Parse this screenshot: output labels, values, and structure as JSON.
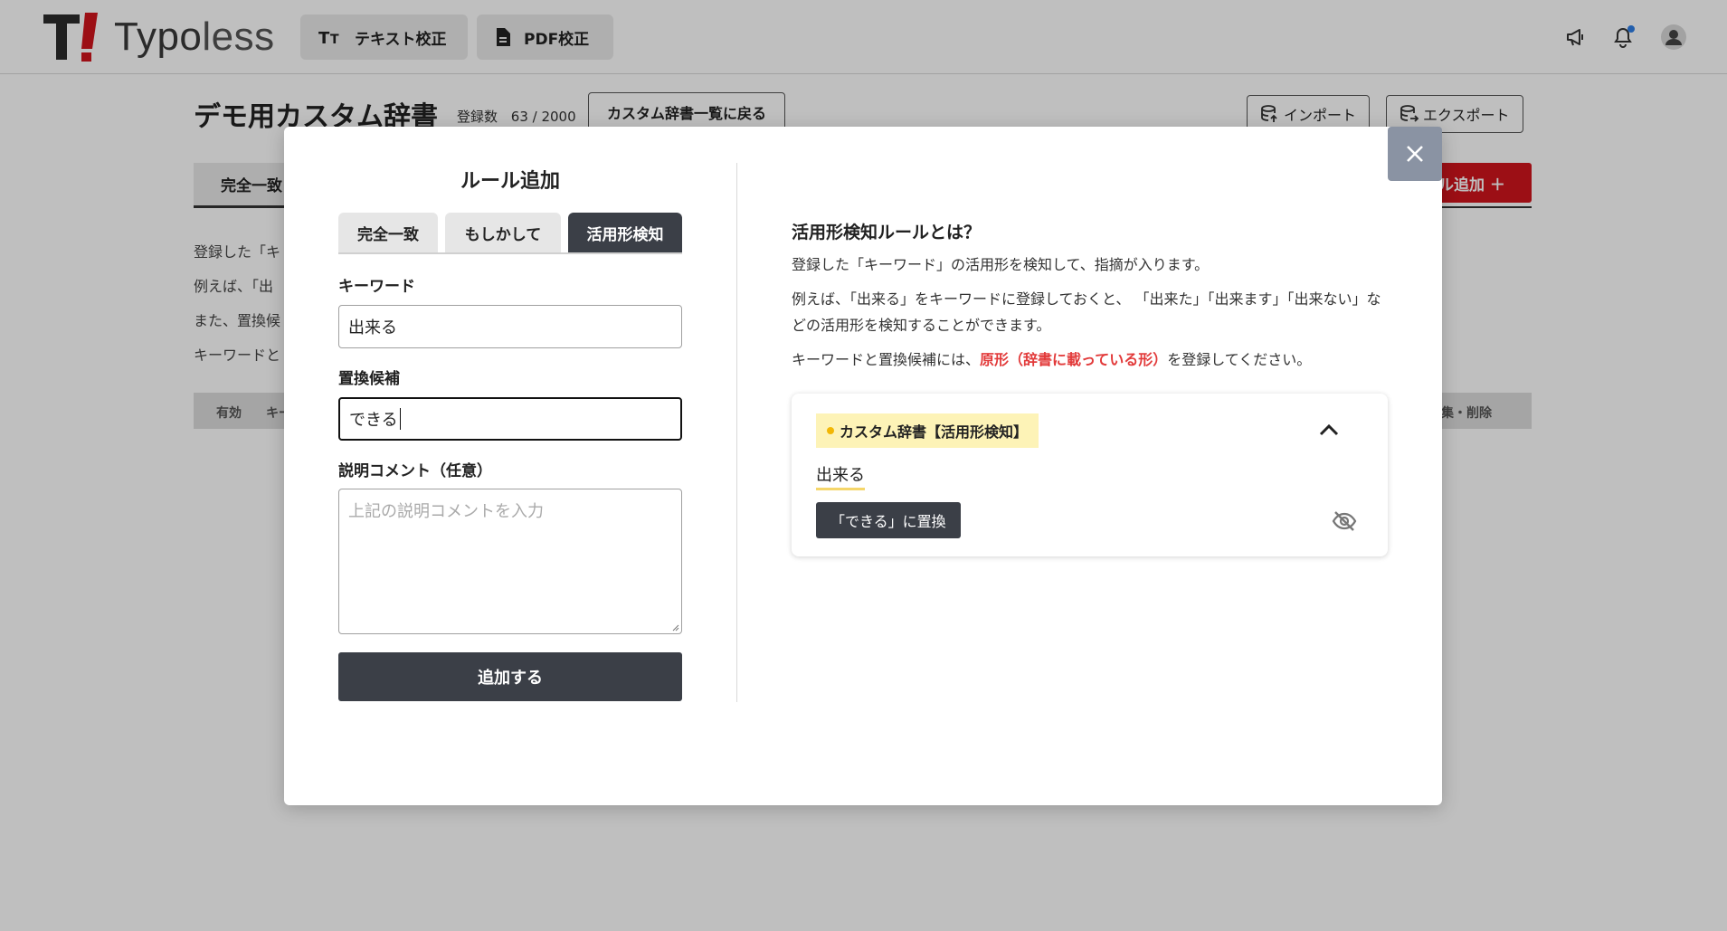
{
  "header": {
    "logo_text_a": "Typo",
    "logo_text_b": "less",
    "nav": [
      {
        "label": "テキスト校正",
        "icon": "text-format-icon"
      },
      {
        "label": "PDF校正",
        "icon": "document-icon"
      }
    ],
    "icons": [
      "megaphone-icon",
      "bell-icon",
      "user-avatar-icon"
    ]
  },
  "page": {
    "title": "デモ用カスタム辞書",
    "count_label": "登録数",
    "count_value": "63 / 2000",
    "back_button": "カスタム辞書一覧に戻る",
    "import_button": "インポート",
    "export_button": "エクスポート",
    "tab_exact": "完全一致",
    "add_rule_button": "ル追加 ＋",
    "desc_lines": [
      "登録した「キ",
      "例えば、「出",
      "また、置換候",
      "キーワードと"
    ],
    "table_headers": [
      "有効",
      "キー",
      "集・削除"
    ]
  },
  "modal": {
    "title": "ルール追加",
    "tabs": [
      {
        "label": "完全一致",
        "active": false
      },
      {
        "label": "もしかして",
        "active": false
      },
      {
        "label": "活用形検知",
        "active": true
      }
    ],
    "keyword_label": "キーワード",
    "keyword_value": "出来る",
    "replace_label": "置換候補",
    "replace_value": "できる",
    "comment_label": "説明コメント（任意）",
    "comment_placeholder": "上記の説明コメントを入力",
    "submit_button": "追加する",
    "info": {
      "title": "活用形検知ルールとは？",
      "p1": "登録した「キーワード」の活用形を検知して、指摘が入ります。",
      "p2": "例えば、「出来る」をキーワードに登録しておくと、 「出来た」「出来ます」「出来ない」などの活用形を検知することができます。",
      "p3_a": "キーワードと置換候補には、",
      "p3_hl": "原形（辞書に載っている形）",
      "p3_b": "を登録してください。"
    },
    "card": {
      "badge": "カスタム辞書【活用形検知】",
      "word": "出来る",
      "replace": "「できる」に置換"
    }
  },
  "colors": {
    "accent_red": "#d0141c",
    "dark_button": "#3b3f47",
    "highlight_red": "#e23a3a",
    "badge_yellow": "#fdf3b7"
  }
}
